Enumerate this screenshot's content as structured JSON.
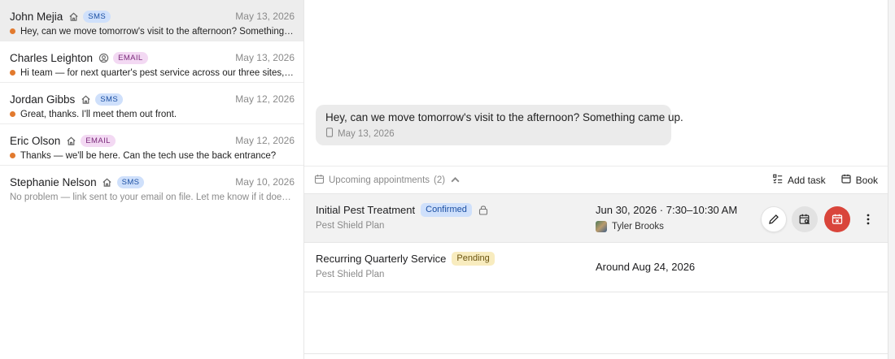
{
  "conversations": [
    {
      "name": "John Mejia",
      "contact_icon": "home-icon",
      "channel": "SMS",
      "date": "May 13, 2026",
      "unread": true,
      "preview": "Hey, can we move tomorrow's visit to the afternoon? Something came up."
    },
    {
      "name": "Charles Leighton",
      "contact_icon": "user-circle-icon",
      "channel": "EMAIL",
      "date": "May 13, 2026",
      "unread": true,
      "preview": "Hi team — for next quarter's pest service across our three sites, please send a quote."
    },
    {
      "name": "Jordan Gibbs",
      "contact_icon": "home-icon",
      "channel": "SMS",
      "date": "May 12, 2026",
      "unread": true,
      "preview": "Great, thanks. I'll meet them out front."
    },
    {
      "name": "Eric Olson",
      "contact_icon": "home-icon",
      "channel": "EMAIL",
      "date": "May 12, 2026",
      "unread": true,
      "preview": "Thanks — we'll be here. Can the tech use the back entrance?"
    },
    {
      "name": "Stephanie Nelson",
      "contact_icon": "home-icon",
      "channel": "SMS",
      "date": "May 10, 2026",
      "unread": false,
      "preview": "No problem — link sent to your email on file. Let me know if it doesn't arrive."
    }
  ],
  "message": {
    "text": "Hey, can we move tomorrow's visit to the afternoon? Something came up.",
    "channel_icon": "phone-icon",
    "date": "May 13, 2026"
  },
  "appointments_header": {
    "label": "Upcoming appointments",
    "count": "(2)",
    "add_task": "Add task",
    "book": "Book"
  },
  "appointments": [
    {
      "title": "Initial Pest Treatment",
      "status": "Confirmed",
      "locked": true,
      "plan": "Pest Shield Plan",
      "when": "Jun 30, 2026 · 7:30–10:30 AM",
      "technician": "Tyler Brooks"
    },
    {
      "title": "Recurring Quarterly Service",
      "status": "Pending",
      "locked": false,
      "plan": "Pest Shield Plan",
      "when": "Around Aug 24, 2026",
      "technician": ""
    }
  ],
  "colors": {
    "unread_dot": "#e27a2e",
    "sms_badge": "#cfe0fb",
    "email_badge": "#f3d9f3",
    "confirmed": "#cfe0fb",
    "pending": "#f8ecbf",
    "cancel_button": "#d9453b"
  }
}
